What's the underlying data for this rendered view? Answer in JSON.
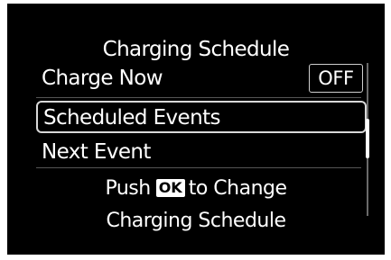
{
  "screen": {
    "title": "Charging Schedule",
    "menu": {
      "charge_now": {
        "label": "Charge Now",
        "value": "OFF"
      },
      "scheduled_events": {
        "label": "Scheduled Events",
        "selected": true
      },
      "next_event": {
        "label": "Next Event"
      }
    },
    "help": {
      "line1_prefix": "Push",
      "button_label": "OK",
      "line1_suffix": "to Change",
      "line2": "Charging Schedule"
    },
    "scroll_position_fraction": 0.4
  }
}
